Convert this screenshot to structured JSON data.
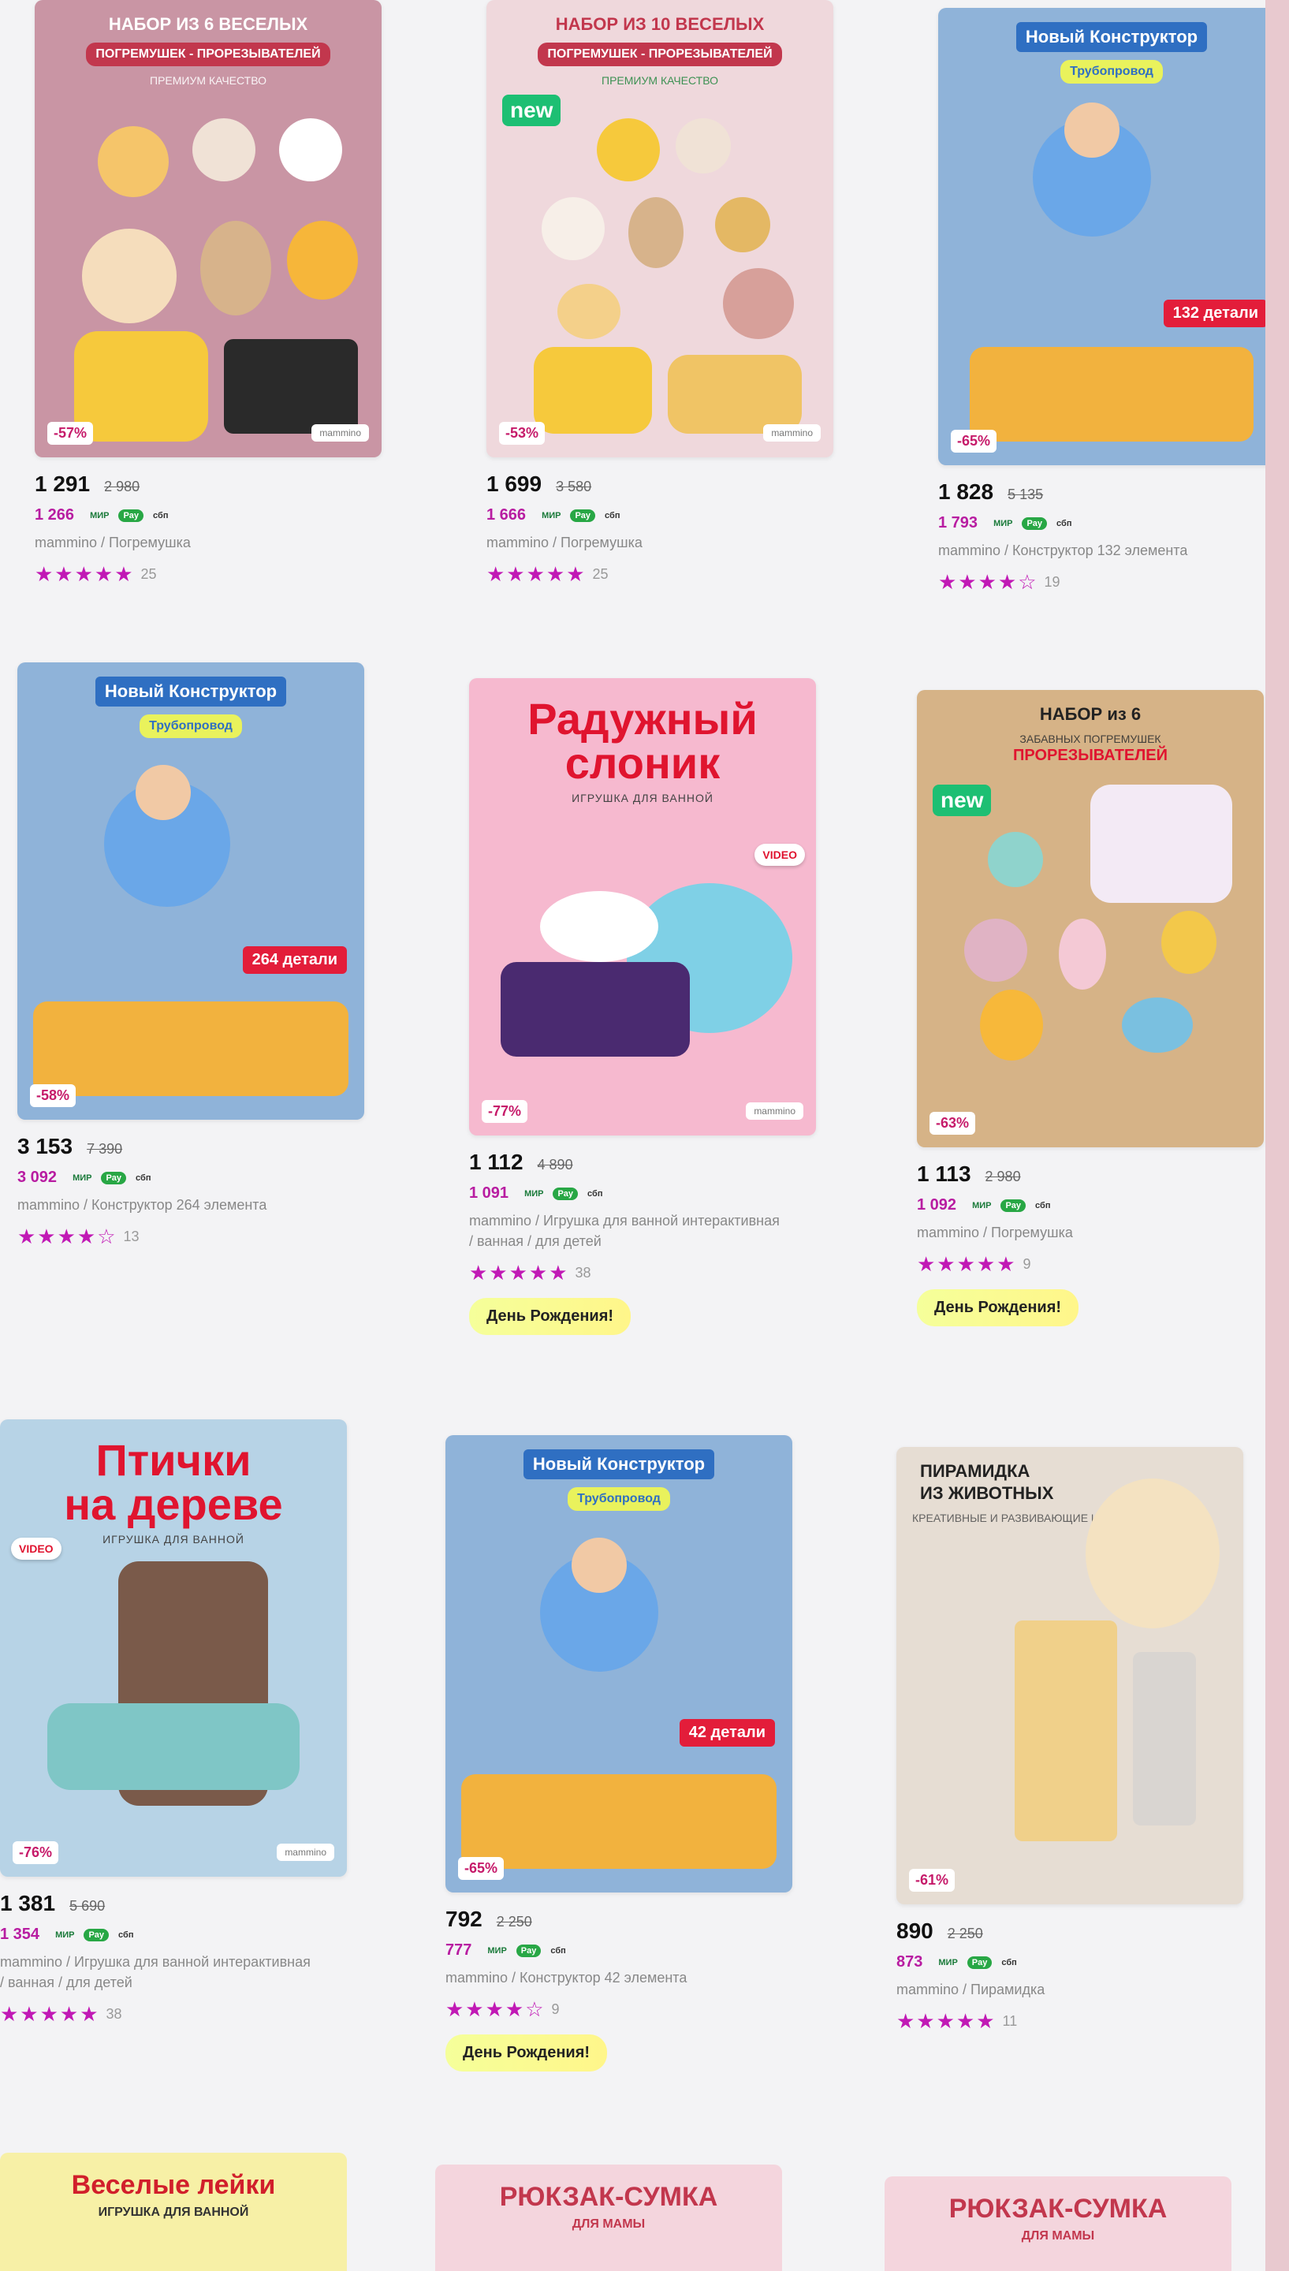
{
  "products": [
    {
      "title_lines": [
        "НАБОР ИЗ 6 ВЕСЕЛЫХ",
        "ПОГРЕМУШЕК - ПРОРЕЗЫВАТЕЛЕЙ",
        "ПРЕМИУМ КАЧЕСТВО"
      ],
      "discount": "-57%",
      "price": "1 291",
      "old_price": "2 980",
      "card_price": "1 266",
      "brand_title": "mammino / Погремушка",
      "stars": "★★★★★",
      "reviews": "25",
      "promo": "",
      "bg": "#c995a4"
    },
    {
      "title_lines": [
        "НАБОР ИЗ 10 ВЕСЕЛЫХ",
        "ПОГРЕМУШЕК - ПРОРЕЗЫВАТЕЛЕЙ",
        "ПРЕМИУМ КАЧЕСТВО"
      ],
      "badge": "new",
      "discount": "-53%",
      "price": "1 699",
      "old_price": "3 580",
      "card_price": "1 666",
      "brand_title": "mammino / Погремушка",
      "stars": "★★★★★",
      "reviews": "25",
      "promo": "",
      "bg": "#efd8dc"
    },
    {
      "title_lines": [
        "Новый Конструктор",
        "Трубопровод"
      ],
      "tag": "132 детали",
      "discount": "-65%",
      "price": "1 828",
      "old_price": "5 135",
      "card_price": "1 793",
      "brand_title": "mammino / Конструктор 132 элемента",
      "stars": "★★★★☆",
      "reviews": "19",
      "promo": "",
      "bg": "#8fb3d9"
    },
    {
      "title_lines": [
        "Новый Конструктор",
        "Трубопровод"
      ],
      "tag": "264 детали",
      "discount": "-58%",
      "price": "3 153",
      "old_price": "7 390",
      "card_price": "3 092",
      "brand_title": "mammino / Конструктор 264 элемента",
      "stars": "★★★★☆",
      "reviews": "13",
      "promo": "",
      "bg": "#8fb3d9"
    },
    {
      "title_lines": [
        "Радужный",
        "слоник",
        "ИГРУШКА ДЛЯ ВАННОЙ"
      ],
      "video": "VIDEO",
      "discount": "-77%",
      "price": "1 112",
      "old_price": "4 890",
      "card_price": "1 091",
      "brand_title": "mammino / Игрушка для ванной интерактивная / ванная / для детей",
      "stars": "★★★★★",
      "reviews": "38",
      "promo": "День Рождения!",
      "bg": "#f6b9cf"
    },
    {
      "title_lines": [
        "НАБОР из 6",
        "ЗАБАВНЫХ ПОГРЕМУШЕК",
        "ПРОРЕЗЫВАТЕЛЕЙ"
      ],
      "badge": "new",
      "discount": "-63%",
      "price": "1 113",
      "old_price": "2 980",
      "card_price": "1 092",
      "brand_title": "mammino / Погремушка",
      "stars": "★★★★★",
      "reviews": "9",
      "promo": "День Рождения!",
      "bg": "#d6b387"
    },
    {
      "title_lines": [
        "Птички",
        "на дереве",
        "ИГРУШКА ДЛЯ ВАННОЙ"
      ],
      "video": "VIDEO",
      "discount": "-76%",
      "price": "1 381",
      "old_price": "5 690",
      "card_price": "1 354",
      "brand_title": "mammino / Игрушка для ванной интерактивная / ванная / для детей",
      "stars": "★★★★★",
      "reviews": "38",
      "promo": "",
      "bg": "#b7d3e6"
    },
    {
      "title_lines": [
        "Новый Конструктор",
        "Трубопровод"
      ],
      "tag": "42 детали",
      "discount": "-65%",
      "price": "792",
      "old_price": "2 250",
      "card_price": "777",
      "brand_title": "mammino / Конструктор 42 элемента",
      "stars": "★★★★☆",
      "reviews": "9",
      "promo": "День Рождения!",
      "bg": "#8fb3d9"
    },
    {
      "title_lines": [
        "ПИРАМИДКА",
        "ИЗ ЖИВОТНЫХ",
        "КРЕАТИВНЫЕ И РАЗВИВАЮЩИЕ ИГРУШКИ"
      ],
      "discount": "-61%",
      "price": "890",
      "old_price": "2 250",
      "card_price": "873",
      "brand_title": "mammino / Пирамидка",
      "stars": "★★★★★",
      "reviews": "11",
      "promo": "",
      "bg": "#e6ddd3"
    }
  ],
  "bottom_cards": [
    {
      "title": "Веселые лейки",
      "subtitle": "ИГРУШКА ДЛЯ ВАННОЙ",
      "bg": "#f7f0a6"
    },
    {
      "title": "РЮКЗАК-СУМКА",
      "subtitle": "ДЛЯ МАМЫ",
      "bg": "#f4d5dd"
    },
    {
      "title": "РЮКЗАК-СУМКА",
      "subtitle": "ДЛЯ МАМЫ",
      "bg": "#f4d5dd"
    }
  ],
  "payment_badges": {
    "mir": "МИР",
    "pay": "Pay",
    "sbp": "сбп"
  },
  "colors": {
    "accent": "#b81ca1",
    "star": "#c119b5",
    "sale": "#e0142f"
  }
}
